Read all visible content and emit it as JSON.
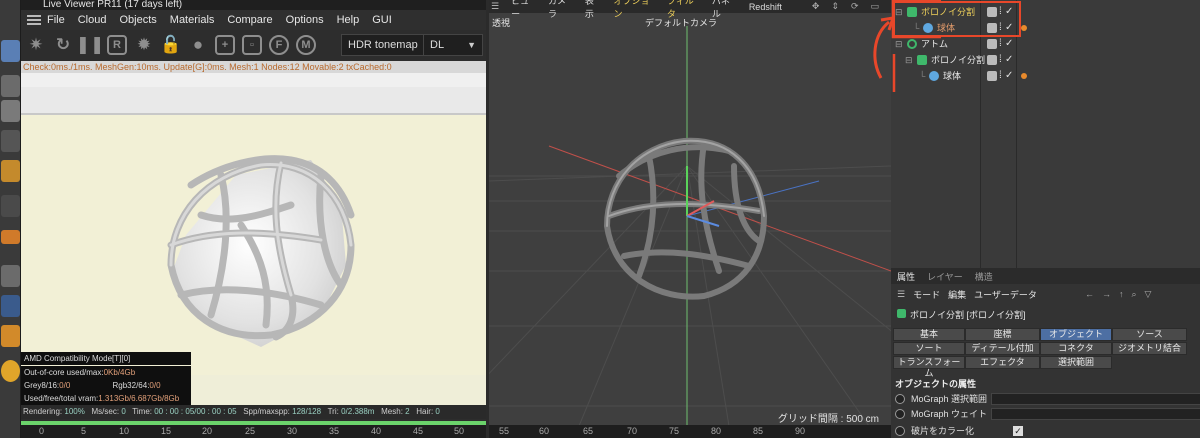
{
  "live_viewer": {
    "title": "Live Viewer PR11 (17 days left)",
    "menu": [
      "File",
      "Cloud",
      "Objects",
      "Materials",
      "Compare",
      "Options",
      "Help",
      "GUI"
    ],
    "tonemap": "HDR tonemap",
    "channel": "DL",
    "status": "Check:0ms./1ms. MeshGen:10ms. Update[G]:0ms. Mesh:1 Nodes:12 Movable:2 txCached:0",
    "overlay": {
      "amd": "AMD Compatibility Mode[T][0]",
      "ooc_label": "Out-of-core used/max:",
      "ooc_value": "0Kb/4Gb",
      "grey_label": "Grey8/16:",
      "grey_value": "0/0",
      "rgb_label": "Rgb32/64:",
      "rgb_value": "0/0",
      "vram_label": "Used/free/total vram:",
      "vram_value": "1.313Gb/6.687Gb/8Gb"
    },
    "render_info": {
      "rendering_label": "Rendering:",
      "rendering_value": "100%",
      "ms_label": "Ms/sec:",
      "ms_value": "0",
      "time_label": "Time:",
      "time_value": "00 : 00 : 05/00 : 00 : 05",
      "spp_label": "Spp/maxspp:",
      "spp_value": "128/128",
      "tri_label": "Tri:",
      "tri_value": "0/2.388m",
      "mesh_label": "Mesh:",
      "mesh_value": "2",
      "hair_label": "Hair:",
      "hair_value": "0"
    },
    "ruler": [
      "0",
      "5",
      "10",
      "15",
      "20",
      "25",
      "30",
      "35",
      "40",
      "45",
      "50"
    ]
  },
  "viewport": {
    "menu": [
      "ビュー",
      "カメラ",
      "表示",
      "オプション",
      "フィルタ",
      "パネル",
      "Redshift"
    ],
    "highlight": [
      "オプション",
      "フィルタ"
    ],
    "projection": "透視",
    "camera": "デフォルトカメラ",
    "grid_label": "グリッド間隔 : 500 cm",
    "ruler": [
      "55",
      "60",
      "65",
      "70",
      "75",
      "80",
      "85",
      "90"
    ]
  },
  "object_manager": {
    "rows": [
      {
        "name": "ボロノイ分割",
        "level": 0,
        "boxed": true
      },
      {
        "name": "球体",
        "level": 1,
        "boxed": true
      },
      {
        "name": "アトム",
        "level": 0,
        "boxed": false
      },
      {
        "name": "ボロノイ分割",
        "level": 1,
        "boxed": false
      },
      {
        "name": "球体",
        "level": 2,
        "boxed": false
      }
    ],
    "accent": "#e8472a"
  },
  "attributes": {
    "tabs": [
      "属性",
      "レイヤー",
      "構造"
    ],
    "menu": [
      "モード",
      "編集",
      "ユーザーデータ"
    ],
    "title": "ボロノイ分割 [ボロノイ分割]",
    "buttons": [
      [
        "基本",
        "座標",
        "オブジェクト",
        "ソース"
      ],
      [
        "ソート",
        "ディテール付加",
        "コネクタ",
        "ジオメトリ結合"
      ],
      [
        "トランスフォーム",
        "エフェクタ",
        "選択範囲"
      ]
    ],
    "active_button": "オブジェクト",
    "section": "オブジェクトの属性",
    "fields": [
      "MoGraph 選択範囲",
      "MoGraph ウェイト",
      "破片をカラー化"
    ]
  }
}
